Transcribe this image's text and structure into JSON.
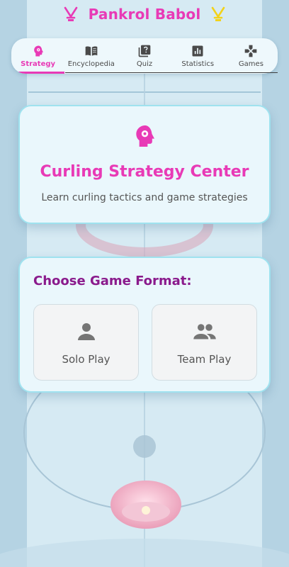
{
  "app": {
    "title": "Pankrol Babol",
    "left_icon": "crossed-hockey-sticks-icon",
    "right_icon": "crossed-hockey-sticks-icon"
  },
  "tabs": [
    {
      "label": "Strategy",
      "icon": "psychology-head-icon",
      "active": true
    },
    {
      "label": "Encyclopedia",
      "icon": "book-icon",
      "active": false
    },
    {
      "label": "Quiz",
      "icon": "quiz-icon",
      "active": false
    },
    {
      "label": "Statistics",
      "icon": "bar-chart-icon",
      "active": false
    },
    {
      "label": "Games",
      "icon": "gamepad-icon",
      "active": false
    }
  ],
  "hero": {
    "icon": "psychology-head-icon",
    "title": "Curling Strategy Center",
    "subtitle": "Learn curling tactics and game strategies"
  },
  "format": {
    "heading": "Choose Game Format:",
    "options": [
      {
        "label": "Solo Play",
        "icon": "person-icon"
      },
      {
        "label": "Team Play",
        "icon": "group-icon"
      }
    ]
  },
  "colors": {
    "accent": "#e83ab6",
    "heading": "#8a1a8c",
    "card_border": "#9fe2ef",
    "card_bg": "#eaf7fc"
  }
}
